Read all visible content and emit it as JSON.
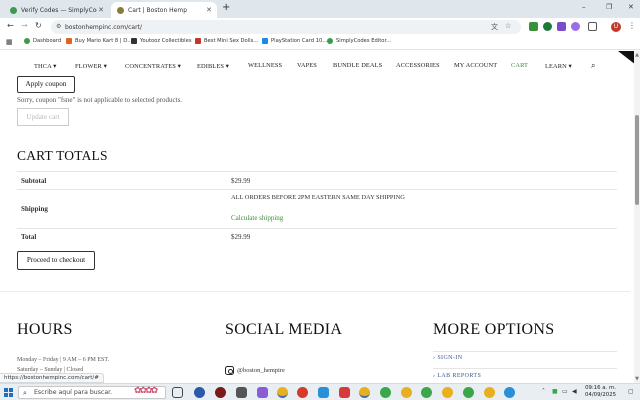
{
  "browser": {
    "tabs": [
      {
        "title": "Verify Codes — SimplyCodes",
        "active": false,
        "favicon_color": "#3b9b4a"
      },
      {
        "title": "Cart | Boston Hemp",
        "active": true,
        "favicon_color": "#8a7a3a"
      }
    ],
    "new_tab_label": "+",
    "window_controls": [
      "–",
      "❐",
      "✕"
    ],
    "url": "bostonhempinc.com/cart/",
    "profile_initial": "U",
    "extension_colors": [
      "#3a8f3a",
      "#1f7a3a",
      "#7b4bc9",
      "#9b6ee8",
      "#555555"
    ],
    "bookmarks": [
      {
        "label": "Dashboard",
        "color": "#3b9b4a"
      },
      {
        "label": "Buy Mario Kart 8 | D...",
        "color": "#e0641e"
      },
      {
        "label": "Youtooz Collectibles",
        "color": "#333333"
      },
      {
        "label": "Best Mini Sex Dolls...",
        "color": "#c0392b"
      },
      {
        "label": "PlayStation Card 10...",
        "color": "#1e88e5"
      },
      {
        "label": "SimplyCodes Editor...",
        "color": "#3b9b4a"
      }
    ]
  },
  "site": {
    "nav": [
      {
        "label": "THCA ▾"
      },
      {
        "label": "FLOWER ▾"
      },
      {
        "label": "CONCENTRATES ▾"
      },
      {
        "label": "EDIBLES ▾"
      },
      {
        "label": "WELLNESS"
      },
      {
        "label": "VAPES"
      },
      {
        "label": "BUNDLE DEALS"
      },
      {
        "label": "ACCESSORIES"
      },
      {
        "label": "MY ACCOUNT"
      },
      {
        "label": "CART",
        "active": true
      },
      {
        "label": "LEARN ▾"
      }
    ],
    "accent_color": "#3e8e3e"
  },
  "cart": {
    "apply_coupon_label": "Apply coupon",
    "coupon_notice": "Sorry, coupon \"fsne\" is not applicable to selected products.",
    "update_cart_label": "Update cart"
  },
  "totals": {
    "title": "CART TOTALS",
    "subtotal_label": "Subtotal",
    "subtotal_value": "$29.99",
    "shipping_label": "Shipping",
    "shipping_note": "ALL ORDERS BEFORE 2PM EASTERN SAME DAY SHIPPING",
    "calculate_shipping_label": "Calculate shipping",
    "total_label": "Total",
    "total_value": "$29.99",
    "checkout_label": "Proceed to checkout"
  },
  "footer": {
    "hours_title": "HOURS",
    "hours_weekday": "Monday – Friday | 9 AM – 6 PM EST.",
    "hours_weekend": "Saturday – Sunday | Closed",
    "social_title": "SOCIAL MEDIA",
    "instagram_handle": "@boston_hempire",
    "more_title": "MORE OPTIONS",
    "options": [
      "SIGN-IN",
      "LAB REPORTS"
    ]
  },
  "status_url": "https://bostonhempinc.com/cart/#",
  "taskbar": {
    "search_placeholder": "Escribe aquí para buscar.",
    "time": "09:16 a. m.",
    "date": "04/09/2025"
  }
}
